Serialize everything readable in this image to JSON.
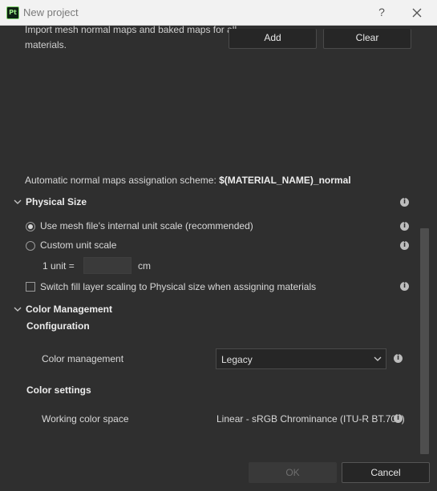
{
  "window": {
    "title": "New project",
    "app_icon_text": "Pt",
    "help_label": "?"
  },
  "normal_maps": {
    "import_text_line1": "Import mesh normal maps and baked maps for all",
    "import_text_line2": "materials.",
    "add_label": "Add",
    "clear_label": "Clear",
    "scheme_label": "Automatic normal maps assignation scheme:",
    "scheme_value": "$(MATERIAL_NAME)_normal"
  },
  "physical_size": {
    "header": "Physical Size",
    "option_mesh": "Use mesh file's internal unit scale (recommended)",
    "option_custom": "Custom unit scale",
    "selected_option": "mesh",
    "unit_label": "1 unit =",
    "unit_value": "",
    "unit_suffix": "cm",
    "switch_label": "Switch fill layer scaling to Physical size when assigning materials",
    "switch_checked": false
  },
  "color_management": {
    "header": "Color Management",
    "configuration_header": "Configuration",
    "color_management_label": "Color management",
    "color_management_value": "Legacy",
    "color_settings_header": "Color settings",
    "working_space_label": "Working color space",
    "working_space_value": "Linear - sRGB Chrominance (ITU-R BT.709)"
  },
  "footer": {
    "ok_label": "OK",
    "cancel_label": "Cancel",
    "ok_enabled": false
  },
  "info_glyph": "i"
}
